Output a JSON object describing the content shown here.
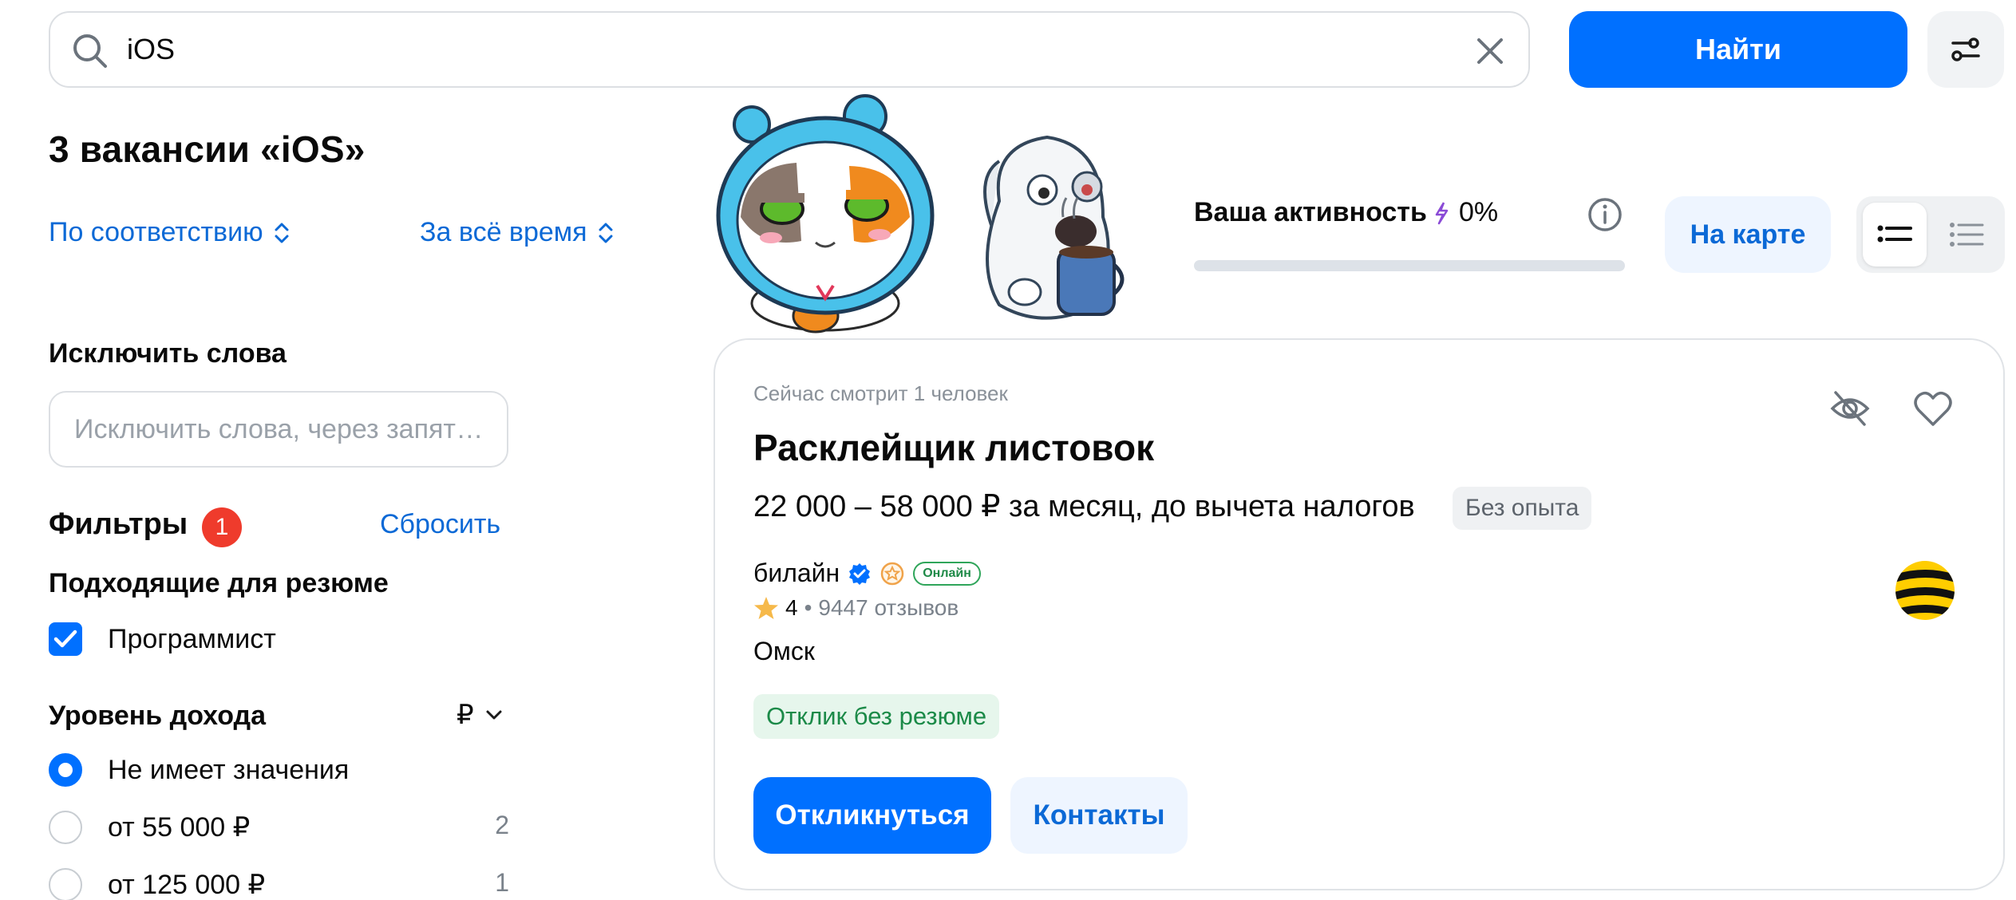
{
  "search": {
    "value": "iOS",
    "find_label": "Найти",
    "icons": {
      "search": "search-icon",
      "clear": "close-icon",
      "settings": "filter-settings-icon"
    }
  },
  "results": {
    "title": "3 вакансии «iOS»",
    "sort_relevance": "По соответствию",
    "sort_period": "За всё время"
  },
  "exclude": {
    "label": "Исключить слова",
    "placeholder": "Исключить слова, через запятую"
  },
  "filters": {
    "title": "Фильтры",
    "badge_count": "1",
    "reset_label": "Сбросить",
    "resume_section": "Подходящие для резюме",
    "resume_option": "Программист",
    "resume_option_checked": true,
    "income_section": "Уровень дохода",
    "currency": "₽",
    "income_options": [
      {
        "label": "Не имеет значения",
        "count": "",
        "selected": true
      },
      {
        "label": "от 55 000 ₽",
        "count": "2",
        "selected": false
      },
      {
        "label": "от 125 000 ₽",
        "count": "1",
        "selected": false
      }
    ]
  },
  "activity": {
    "label": "Ваша активность",
    "percent_text": "0%",
    "progress_fraction": 0
  },
  "view": {
    "map_label": "На карте",
    "list_mode": "compact-list-icon",
    "detail_mode": "detailed-list-icon"
  },
  "vacancy": {
    "viewers": "Сейчас смотрит 1 человек",
    "title": "Расклейщик листовок",
    "salary": "22 000 – 58 000 ₽ за месяц, до вычета налогов",
    "experience": "Без опыта",
    "company": "билайн",
    "online": "Онлайн",
    "rating": "4",
    "reviews": "9447 отзывов",
    "city": "Омск",
    "no_resume": "Отклик без резюме",
    "apply_label": "Откликнуться",
    "contacts_label": "Контакты"
  },
  "colors": {
    "accent": "#0070ff",
    "link": "#0b69d6",
    "badge_red": "#ef3b2c",
    "success": "#1b8a48",
    "beeline_yellow": "#ffcd00"
  }
}
